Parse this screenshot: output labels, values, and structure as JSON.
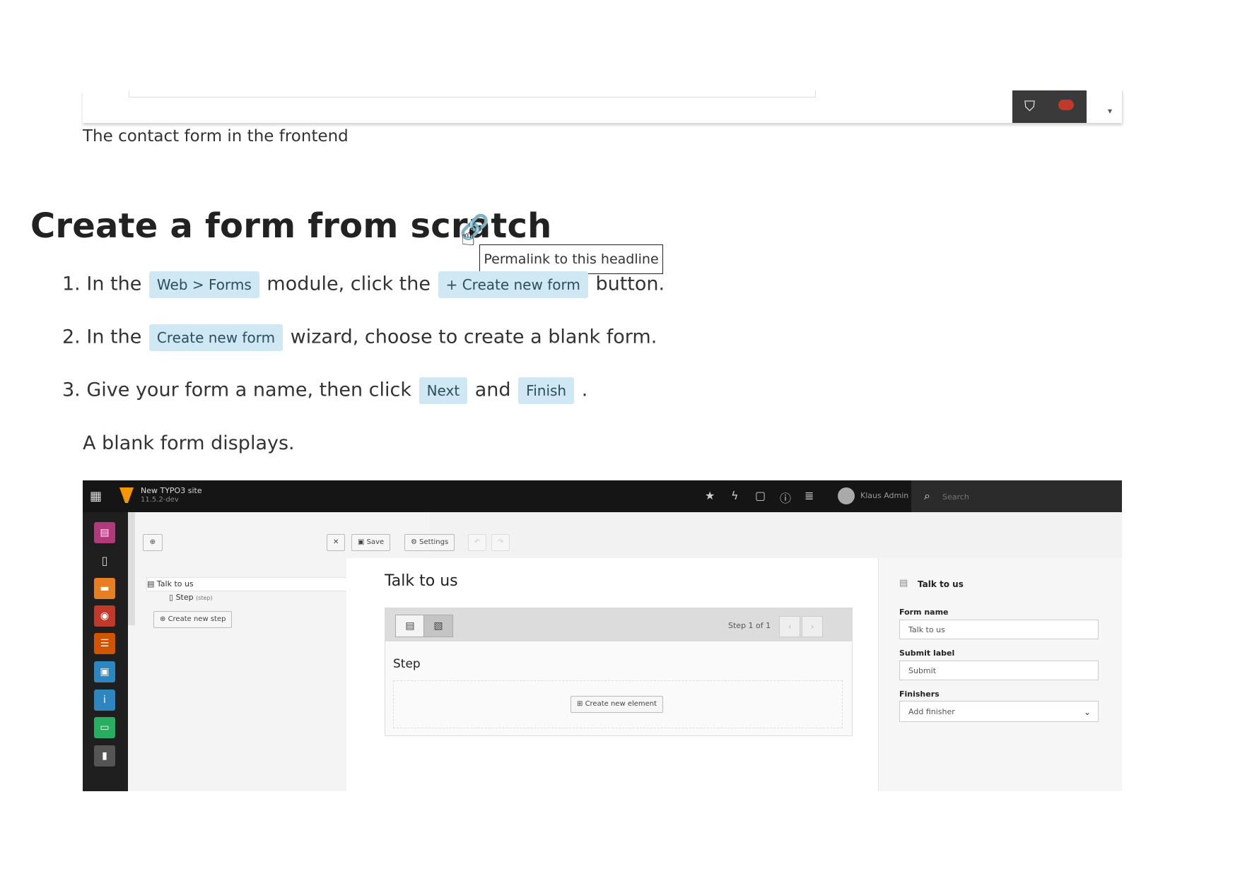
{
  "top_caption": "The contact form in the frontend",
  "heading": "Create a form from scratch",
  "permalink_tooltip": "Permalink to this headline",
  "steps": [
    {
      "num": "1.",
      "pre": "In the",
      "tag1": "Web > Forms",
      "mid": "module, click the",
      "tag2": "+ Create new form",
      "post": "button."
    },
    {
      "num": "2.",
      "pre": "In the",
      "tag1": "Create new form",
      "post": "wizard, choose to create a blank form."
    },
    {
      "num": "3.",
      "pre": "Give your form a name, then click",
      "tag1": "Next",
      "mid": "and",
      "tag2": "Finish",
      "post": "."
    }
  ],
  "note": "A blank form displays.",
  "typo3": {
    "site_name": "New TYPO3 site",
    "site_version": "11.5.2-dev",
    "user_name": "Klaus Admin",
    "search_placeholder": "Search",
    "tree": {
      "root": "Talk to us",
      "child": "Step",
      "child_suffix": "(step)",
      "create_step": "Create new step"
    },
    "toolbar": {
      "save": "Save",
      "settings": "Settings"
    },
    "stage": {
      "title": "Talk to us",
      "step_of": "Step 1 of 1",
      "step_label": "Step",
      "create_element": "Create new element"
    },
    "inspector": {
      "title": "Talk to us",
      "form_name_label": "Form name",
      "form_name_value": "Talk to us",
      "submit_label_label": "Submit label",
      "submit_label_value": "Submit",
      "finishers_label": "Finishers",
      "finishers_value": "Add finisher"
    }
  }
}
